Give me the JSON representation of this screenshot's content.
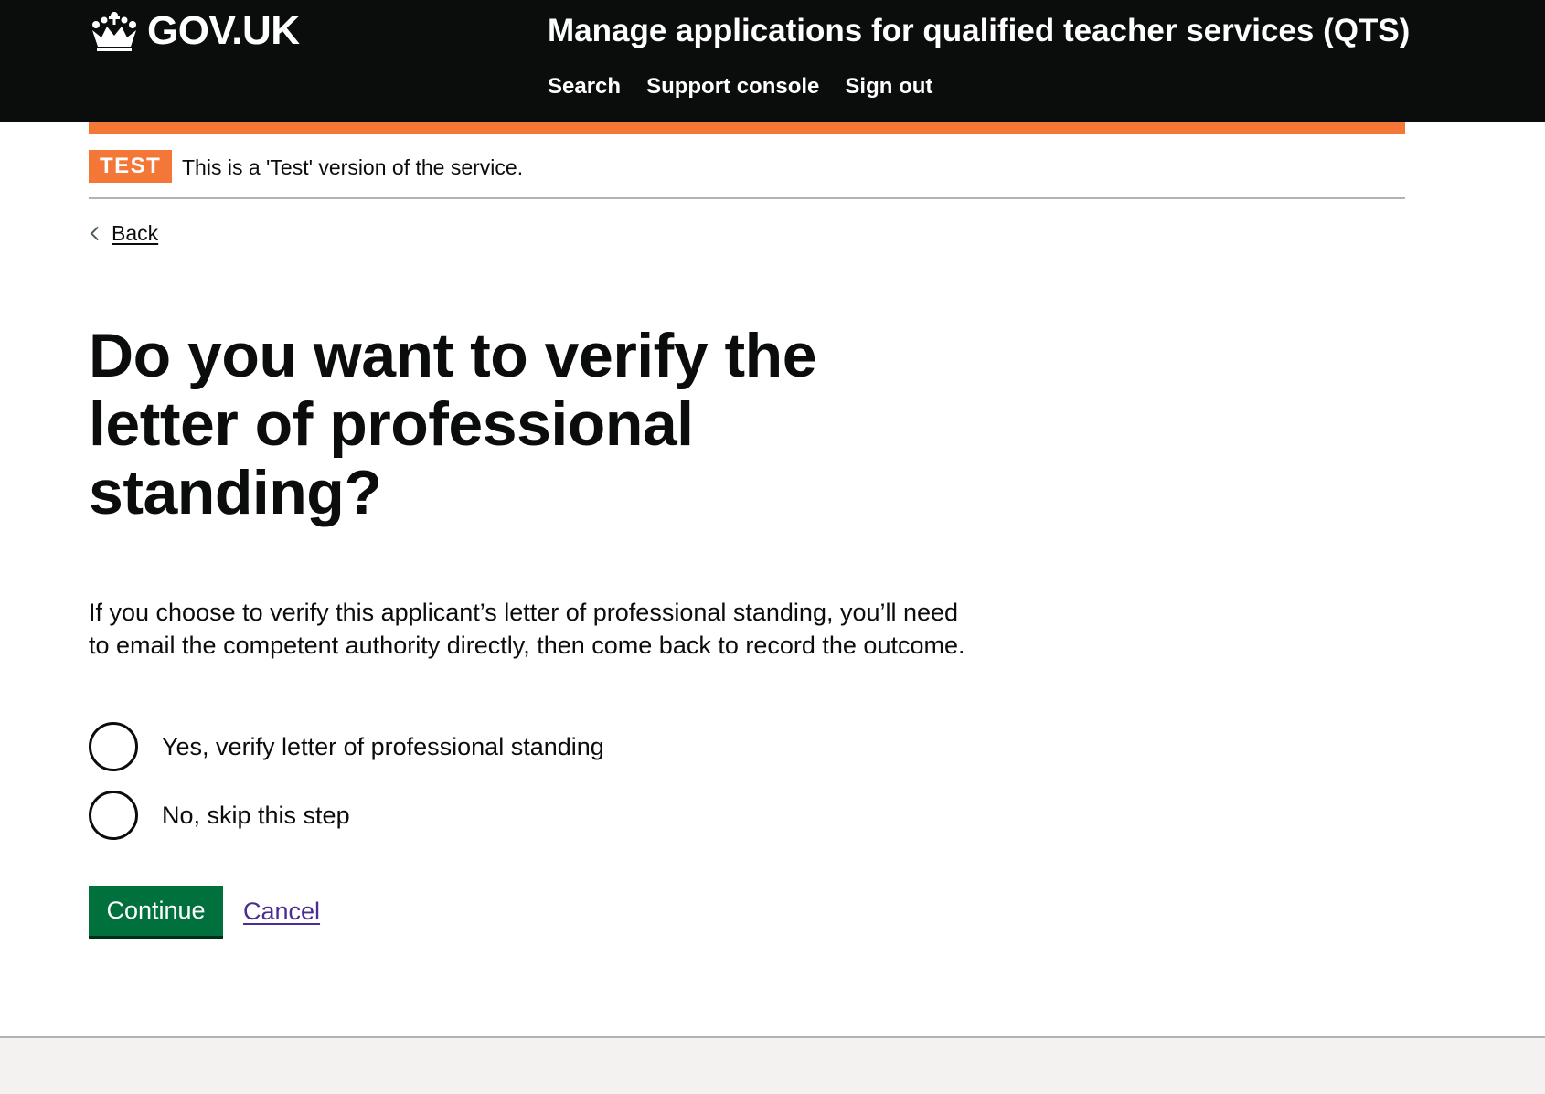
{
  "header": {
    "logo_text": "GOV.UK",
    "logo_icon": "crown-icon",
    "service_name": "Manage applications for qualified teacher services (QTS)",
    "nav": [
      {
        "label": "Search"
      },
      {
        "label": "Support console"
      },
      {
        "label": "Sign out"
      }
    ]
  },
  "phase_banner": {
    "tag": "TEST",
    "text": "This is a 'Test' version of the service."
  },
  "back_link": {
    "label": "Back",
    "icon": "chevron-left-icon"
  },
  "main": {
    "heading": "Do you want to verify the letter of professional standing?",
    "hint": "If you choose to verify this applicant’s letter of professional standing, you’ll need to email the competent authority directly, then come back to record the outcome.",
    "options": [
      {
        "label": "Yes, verify letter of professional standing",
        "selected": false
      },
      {
        "label": "No, skip this step",
        "selected": false
      }
    ],
    "continue_label": "Continue",
    "cancel_label": "Cancel"
  },
  "colors": {
    "header_bg": "#0b0c0c",
    "phase_orange": "#f47738",
    "button_green": "#00703c",
    "link_purple": "#4c2c92",
    "footer_bg": "#f3f2f1"
  }
}
